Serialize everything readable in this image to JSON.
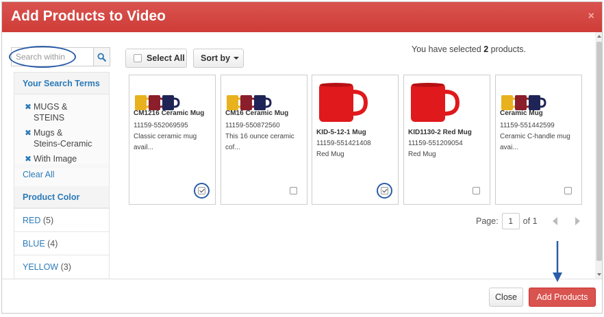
{
  "dialog": {
    "title": "Add Products to Video",
    "close_glyph": "×"
  },
  "search": {
    "placeholder": "Search within",
    "value": ""
  },
  "sidebar": {
    "search_terms_heading": "Your Search Terms",
    "terms": [
      {
        "label": "MUGS &",
        "label2": "STEINS"
      },
      {
        "label": "Mugs &",
        "label2": "Steins-Ceramic"
      },
      {
        "label": "With Image",
        "label2": ""
      }
    ],
    "remove_glyph": "✖",
    "clear_all_label": "Clear All",
    "product_color_heading": "Product Color",
    "colors": [
      {
        "name": "RED",
        "count": "(5)"
      },
      {
        "name": "BLUE",
        "count": "(4)"
      },
      {
        "name": "YELLOW",
        "count": "(3)"
      }
    ]
  },
  "toolbar": {
    "select_all_label": "Select All",
    "sort_by_label": "Sort by"
  },
  "selection": {
    "prefix": "You have selected ",
    "count": "2",
    "suffix": " products."
  },
  "products": [
    {
      "name": "CM1216  Ceramic Mug",
      "sku": "11159-552069595",
      "desc": "Classic ceramic mug avail...",
      "image": "three-mugs",
      "checked": true
    },
    {
      "name": "CM16  Ceramic Mug",
      "sku": "11159-550872560",
      "desc": "This 16 ounce ceramic cof...",
      "image": "three-mugs",
      "checked": false
    },
    {
      "name": "KID-5-12-1  Mug",
      "sku": "11159-551421408",
      "desc": "Red Mug",
      "image": "red-mug",
      "checked": true
    },
    {
      "name": "KID1130-2  Red Mug",
      "sku": "11159-551209054",
      "desc": "Red Mug",
      "image": "red-mug",
      "checked": false
    },
    {
      "name": "Ceramic Mug",
      "sku": "11159-551442599",
      "desc": "Ceramic C-handle mug avai...",
      "image": "three-mugs",
      "checked": false
    }
  ],
  "pager": {
    "label": "Page:",
    "current": "1",
    "of_label": "of 1"
  },
  "footer": {
    "close_label": "Close",
    "add_label": "Add Products"
  },
  "colors": {
    "header_red": "#d9534f",
    "link_blue": "#2a7ab8",
    "annotation_blue": "#2a5ca8",
    "mug_yellow": "#e8b21f",
    "mug_maroon": "#8b1e2b",
    "mug_navy": "#1f2457",
    "mug_red": "#e0191c"
  }
}
